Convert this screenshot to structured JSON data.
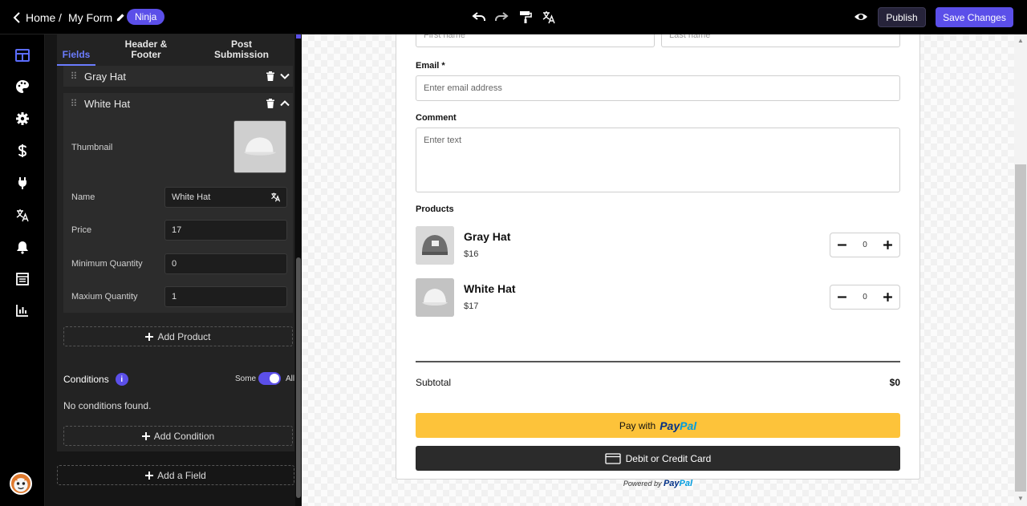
{
  "topbar": {
    "home_label": "Home",
    "separator": "/",
    "form_name": "My Form",
    "badge": "Ninja",
    "publish_label": "Publish",
    "save_label": "Save Changes"
  },
  "rail": {
    "icons": [
      "fields-grid-icon",
      "palette-icon",
      "gear-icon",
      "dollar-icon",
      "plug-icon",
      "translate-icon",
      "bell-icon",
      "calendar-icon",
      "bar-chart-icon"
    ]
  },
  "panel": {
    "tabs": [
      {
        "label_line1": "Fields",
        "label_line2": "",
        "active": true
      },
      {
        "label_line1": "Header &",
        "label_line2": "Footer",
        "active": false
      },
      {
        "label_line1": "Post",
        "label_line2": "Submission",
        "active": false
      }
    ],
    "products": [
      {
        "label": "Gray Hat",
        "expanded": false
      },
      {
        "label": "White Hat",
        "expanded": true
      }
    ],
    "detail": {
      "thumbnail_label": "Thumbnail",
      "name_label": "Name",
      "name_value": "White Hat",
      "price_label": "Price",
      "price_value": "17",
      "min_label": "Minimum Quantity",
      "min_value": "0",
      "max_label": "Maxium Quantity",
      "max_value": "1"
    },
    "add_product_label": "Add Product",
    "conditions_title": "Conditions",
    "toggle_left": "Some",
    "toggle_right": "All",
    "no_conditions": "No conditions found.",
    "add_condition_label": "Add Condition",
    "add_field_label": "Add a Field"
  },
  "form": {
    "first_name_placeholder": "First name",
    "last_name_placeholder": "Last name",
    "email_label": "Email *",
    "email_placeholder": "Enter email address",
    "comment_label": "Comment",
    "comment_placeholder": "Enter text",
    "products_label": "Products",
    "items": [
      {
        "name": "Gray Hat",
        "price": "$16",
        "qty": "0"
      },
      {
        "name": "White Hat",
        "price": "$17",
        "qty": "0"
      }
    ],
    "subtotal_label": "Subtotal",
    "subtotal_value": "$0",
    "paypal_prefix": "Pay with",
    "paypal_logo_a": "Pay",
    "paypal_logo_b": "Pal",
    "card_label": "Debit or Credit Card",
    "powered_by": "Powered by"
  },
  "colors": {
    "accent": "#5b4fe9",
    "paypal_yellow": "#fdc33a"
  }
}
